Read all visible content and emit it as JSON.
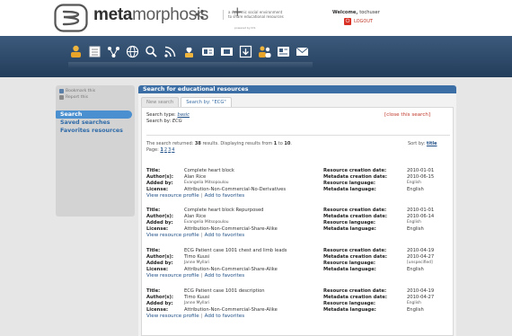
{
  "header": {
    "logo_bold": "meta",
    "logo_light": "morphosis",
    "logo_plus": "+",
    "logo_sub": "powered by ICS",
    "tagline_line1": "a dynamic social environment",
    "tagline_line2": "to share educational resources",
    "welcome_label": "Welcome, ",
    "welcome_user": "tochuser",
    "logout_label": "LOGOUT",
    "accent": "#233d5b"
  },
  "nav": {
    "icons": [
      "user-icon",
      "document-stack-icon",
      "network-icon",
      "globe-icon",
      "search-icon",
      "rss-icon",
      "plant-icon",
      "id-card-icon",
      "film-icon",
      "download-icon",
      "users-icon",
      "newspaper-icon",
      "envelope-icon"
    ]
  },
  "sidebar": {
    "bookmark": "Bookmark this",
    "report": "Report this",
    "menu": [
      "Search",
      "Saved searches",
      "Favorites resources"
    ]
  },
  "main": {
    "title": "Search for educational resources",
    "tabs": [
      "New search",
      "Search by: \"ECG\""
    ],
    "search_type_label": "Search type: ",
    "search_type_value": "basic",
    "search_by_label": "Search by: ",
    "search_by_value": "ECG",
    "close_label": "[close this search]",
    "returned_pre": "The search returned: ",
    "returned_count": "38",
    "returned_mid": " results. Displaying results from ",
    "range_from": "1",
    "returned_to": " to ",
    "range_to": "10",
    "returned_end": ".",
    "page_label": "Page: ",
    "pages": [
      "1",
      "2",
      "3",
      "4"
    ],
    "sort_label": "Sort by: ",
    "sort_value": "title"
  },
  "labels": {
    "title": "Title:",
    "authors": "Author(s):",
    "added_by": "Added by:",
    "license": "License:",
    "res_date": "Resource creation date:",
    "meta_date": "Metadata creation date:",
    "res_lang": "Resource language:",
    "meta_lang": "Metadata language:",
    "view_profile": "View resource profile",
    "sep": "|",
    "add_fav": "Add to favorites"
  },
  "results": [
    {
      "title": "Complete heart block",
      "authors": "Alan Rice",
      "added_by": "Evangelia Mitsopoulou",
      "license": "Attribution-Non-Commercial-No-Derivatives",
      "res_date": "2010-01-01",
      "meta_date": "2010-06-15",
      "res_lang": "English",
      "meta_lang": "English"
    },
    {
      "title": "Complete heart block Repurposed",
      "authors": "Alan Rice",
      "added_by": "Evangelia Mitsopoulou",
      "license": "Attribution-Non-Commercial-Share-Alike",
      "res_date": "2010-01-01",
      "meta_date": "2010-06-14",
      "res_lang": "English",
      "meta_lang": "English"
    },
    {
      "title": "ECG Patient case 1001 chest and limb leads",
      "authors": "Timo Kuusi",
      "added_by": "Janne Myllari",
      "license": "Attribution-Non-Commercial-Share-Alike",
      "res_date": "2010-04-19",
      "meta_date": "2010-04-27",
      "res_lang": "[unspecified]",
      "meta_lang": "English"
    },
    {
      "title": "ECG Patient case 1001 description",
      "authors": "Timo Kuusi",
      "added_by": "Janne Myllari",
      "license": "Attribution-Non-Commercial-Share-Alike",
      "res_date": "2010-04-19",
      "meta_date": "2010-04-27",
      "res_lang": "English",
      "meta_lang": "English"
    }
  ]
}
